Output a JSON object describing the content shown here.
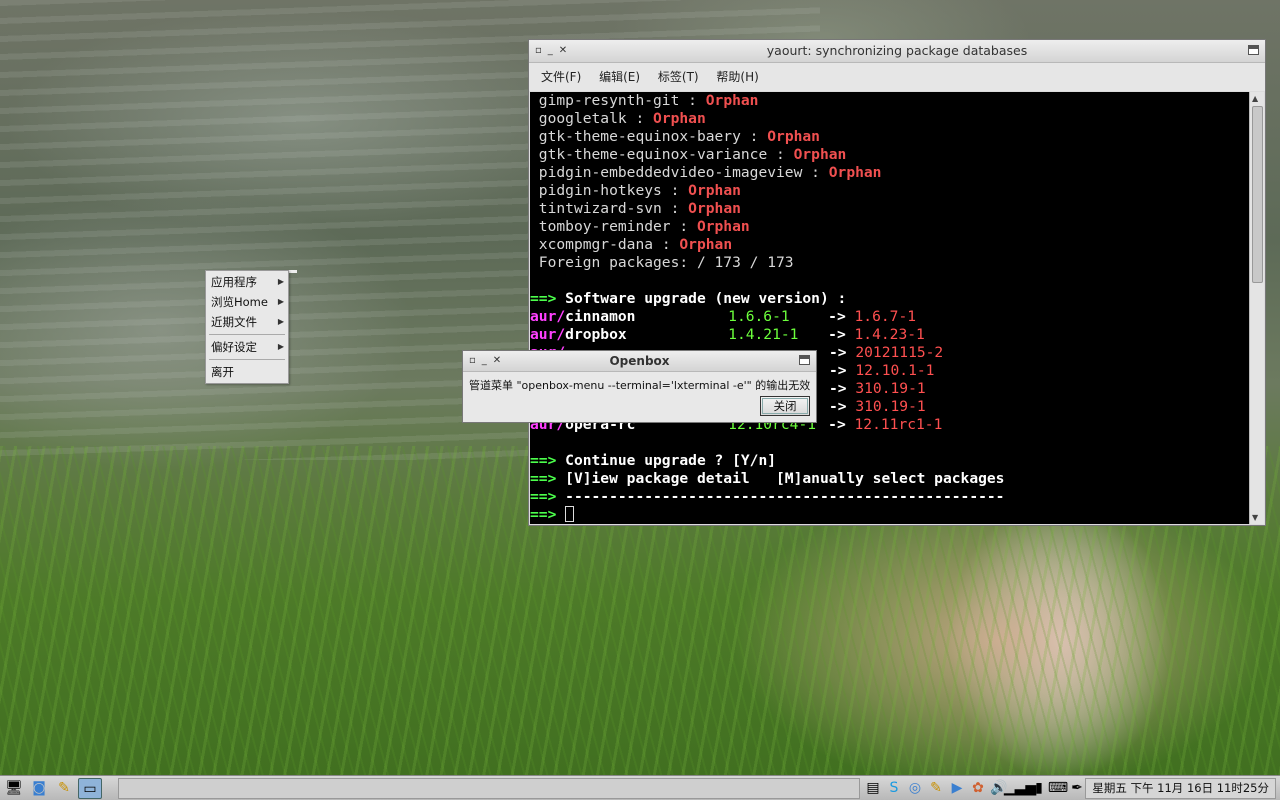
{
  "context_menu": {
    "items": [
      {
        "label": "应用程序",
        "submenu": true
      },
      {
        "label": "浏览Home",
        "submenu": true
      },
      {
        "label": "近期文件",
        "submenu": true
      },
      {
        "label": "偏好设定",
        "submenu": true
      },
      {
        "label": "离开",
        "submenu": false
      }
    ]
  },
  "terminal": {
    "title": "yaourt: synchronizing package databases",
    "menu": [
      "文件(F)",
      "编辑(E)",
      "标签(T)",
      "帮助(H)"
    ],
    "orphans": [
      {
        "name": "gimp-resynth-git",
        "status": "Orphan"
      },
      {
        "name": "googletalk",
        "status": "Orphan"
      },
      {
        "name": "gtk-theme-equinox-baery",
        "status": "Orphan"
      },
      {
        "name": "gtk-theme-equinox-variance",
        "status": "Orphan"
      },
      {
        "name": "pidgin-embeddedvideo-imageview",
        "status": "Orphan"
      },
      {
        "name": "pidgin-hotkeys",
        "status": "Orphan"
      },
      {
        "name": "tintwizard-svn",
        "status": "Orphan"
      },
      {
        "name": "tomboy-reminder",
        "status": "Orphan"
      },
      {
        "name": "xcompmgr-dana",
        "status": "Orphan"
      }
    ],
    "foreign": "Foreign packages: / 173 / 173",
    "arrow": "==>",
    "upgrade_header": "Software upgrade (new version) :",
    "upgrades": [
      {
        "repo": "aur/",
        "name": "cinnamon",
        "old": "1.6.6-1",
        "new": "1.6.7-1"
      },
      {
        "repo": "aur/",
        "name": "dropbox",
        "old": "1.4.21-1",
        "new": "1.4.23-1"
      },
      {
        "repo": "aur/",
        "name": "",
        "old": "",
        "new": "20121115-2"
      },
      {
        "repo": "",
        "name": "",
        "old": "",
        "new": "12.10.1-1"
      },
      {
        "repo": "",
        "name": "",
        "old": "",
        "new": "310.19-1"
      },
      {
        "repo": "",
        "name": "",
        "old": "",
        "new": "310.19-1"
      },
      {
        "repo": "aur/",
        "name": "opera-rc",
        "old": "12.10rc4-1",
        "new": "12.11rc1-1"
      }
    ],
    "continue_prompt": "Continue upgrade ? [Y/n]",
    "view_option": "[V]iew package detail   [M]anually select packages",
    "separator": "--------------------------------------------------"
  },
  "dialog": {
    "title": "Openbox",
    "message": "管道菜单 \"openbox-menu --terminal='lxterminal -e'\" 的输出无效",
    "close_label": "关闭"
  },
  "taskbar": {
    "clock": "星期五 下午 11月 16日 11时25分"
  }
}
